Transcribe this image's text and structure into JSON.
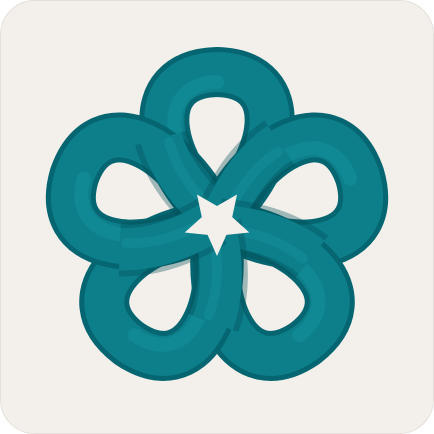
{
  "icon": {
    "name": "five-petal-interlaced-knot-icon",
    "background_color": "#f3f0eb",
    "edge_color": "#e4dfd8",
    "knot_colors": {
      "light": "#16909c",
      "mid": "#0c7f8b",
      "dark": "#056570",
      "shadow": "#034c55"
    },
    "petal_count": 5
  }
}
